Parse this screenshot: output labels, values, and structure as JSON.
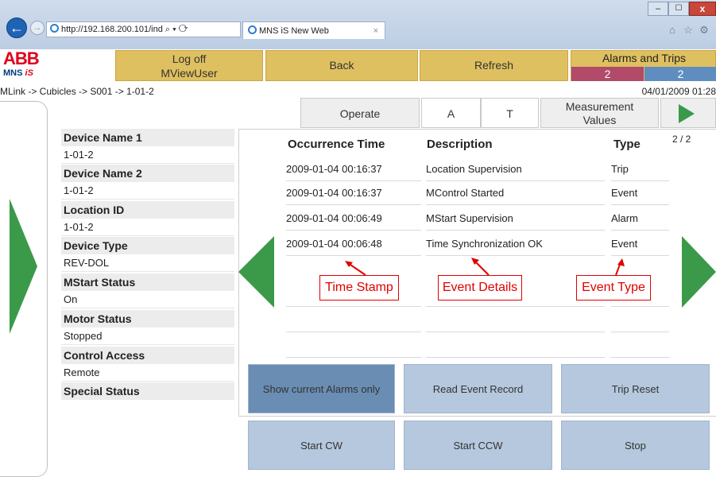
{
  "browser": {
    "address": "http://192.168.200.101/ind",
    "tab_title": "MNS iS New Web",
    "tab_close": "×"
  },
  "header": {
    "logo": "ABB",
    "product": "MNS",
    "product_suffix": "iS",
    "logoff_line1": "Log off",
    "logoff_line2": "MViewUser",
    "back": "Back",
    "refresh": "Refresh",
    "alarms_title": "Alarms and Trips",
    "alarm_count": "2",
    "trip_count": "2",
    "alarm_color": "#b24a6a",
    "trip_color": "#5f8dbf"
  },
  "breadcrumb": "MLink -> Cubicles -> S001 -> 1-01-2",
  "timestamp": "04/01/2009 01:28",
  "tabs": {
    "operate": "Operate",
    "a": "A",
    "t": "T",
    "measurement_line1": "Measurement",
    "measurement_line2": "Values"
  },
  "device_info": [
    {
      "label": "Device Name 1",
      "value": "1-01-2"
    },
    {
      "label": "Device Name 2",
      "value": "1-01-2"
    },
    {
      "label": "Location ID",
      "value": "1-01-2"
    },
    {
      "label": "Device Type",
      "value": "REV-DOL"
    },
    {
      "label": "MStart Status",
      "value": "On"
    },
    {
      "label": "Motor Status",
      "value": "Stopped"
    },
    {
      "label": "Control Access",
      "value": "Remote"
    },
    {
      "label": "Special Status",
      "value": ""
    }
  ],
  "events": {
    "headers": [
      "Occurrence Time",
      "Description",
      "Type"
    ],
    "page": "2 / 2",
    "rows": [
      [
        "2009-01-04 00:16:37",
        "Location Supervision",
        "Trip"
      ],
      [
        "2009-01-04 00:16:37",
        "MControl Started",
        "Event"
      ],
      [
        "2009-01-04 00:06:49",
        "MStart Supervision",
        "Alarm"
      ],
      [
        "2009-01-04 00:06:48",
        "Time Synchronization OK",
        "Event"
      ]
    ]
  },
  "annotations": {
    "time": "Time Stamp",
    "event": "Event Details",
    "type": "Event Type"
  },
  "actions": {
    "show_alarms": "Show current Alarms only",
    "read_event": "Read Event Record",
    "trip_reset": "Trip Reset",
    "start_cw": "Start CW",
    "start_ccw": "Start CCW",
    "stop": "Stop"
  },
  "colors": {
    "accent_green": "#3a9a4a",
    "header_button": "#dfc060",
    "action_button": "#b5c8dd",
    "action_button_active": "#6a8db3",
    "annotation": "#e00000"
  }
}
